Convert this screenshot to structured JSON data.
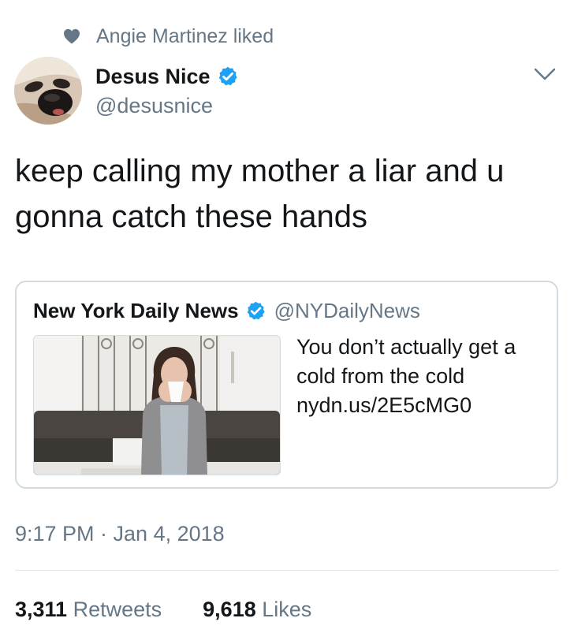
{
  "context": {
    "text": "Angie Martinez liked",
    "icon": "heart-icon"
  },
  "author": {
    "display_name": "Desus Nice",
    "handle": "@desusnice",
    "verified": true,
    "verified_color": "#1da1f2"
  },
  "tweet": {
    "text": "keep calling my mother a liar and u gonna catch these hands"
  },
  "quoted": {
    "display_name": "New York Daily News",
    "handle": "@NYDailyNews",
    "verified": true,
    "text": "You don’t actually get a cold from the cold nydn.us/2E5cMG0"
  },
  "timestamp": "9:17 PM · Jan 4, 2018",
  "stats": {
    "retweets_count": "3,311",
    "retweets_label": "Retweets",
    "likes_count": "9,618",
    "likes_label": "Likes"
  },
  "colors": {
    "text": "#14171a",
    "secondary": "#657786",
    "border": "#d2dbe2",
    "verified": "#1da1f2"
  }
}
